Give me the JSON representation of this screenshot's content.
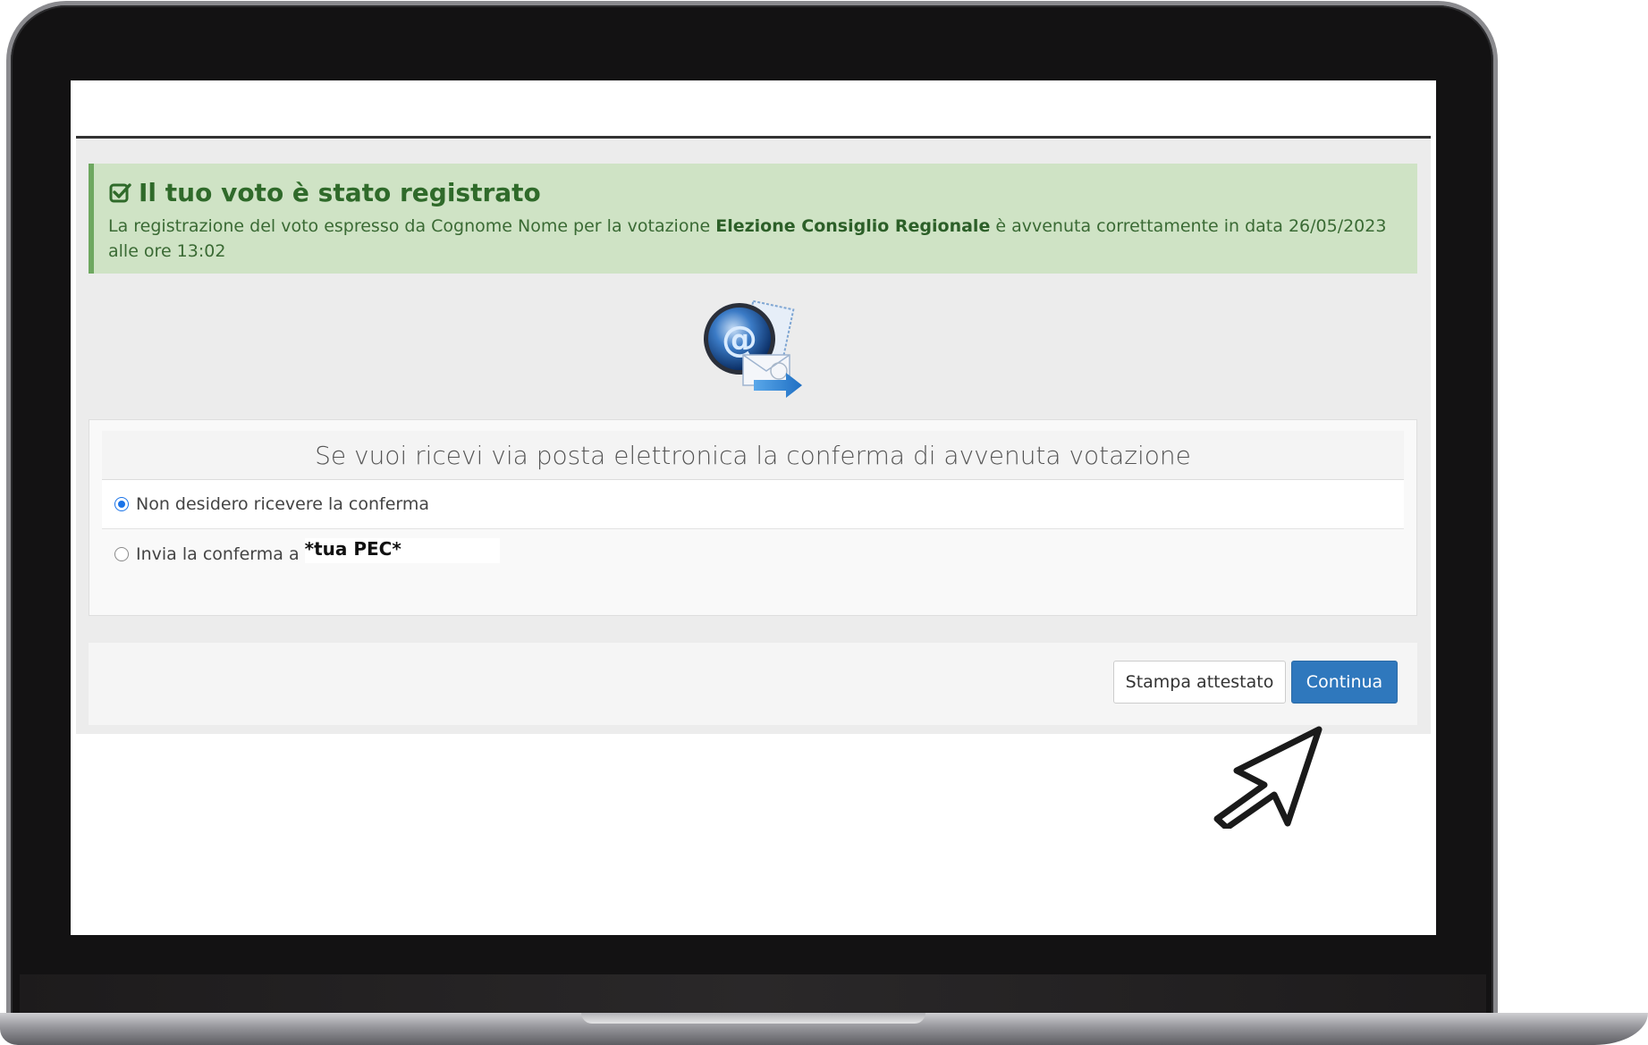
{
  "alert": {
    "title": "Il tuo voto è stato registrato",
    "text_before": "La registrazione del voto espresso da Cognome Nome per la votazione ",
    "election": "Elezione Consiglio Regionale",
    "text_after": " è avvenuta correttamente in data 26/05/2023 alle ore 13:02",
    "icon": "check-square-icon"
  },
  "confirm": {
    "heading": "Se vuoi ricevi via posta elettronica la conferma di avvenuta votazione",
    "options": [
      {
        "label": "Non desidero ricevere la conferma",
        "checked": true
      },
      {
        "label": "Invia la conferma a",
        "value": "*tua PEC*",
        "checked": false
      }
    ]
  },
  "buttons": {
    "print": "Stampa attestato",
    "continue": "Continua"
  },
  "colors": {
    "alert_bg": "#cfe3c5",
    "alert_text": "#2f6a2a",
    "primary": "#2f78bd",
    "radio_checked": "#1a73e8"
  }
}
